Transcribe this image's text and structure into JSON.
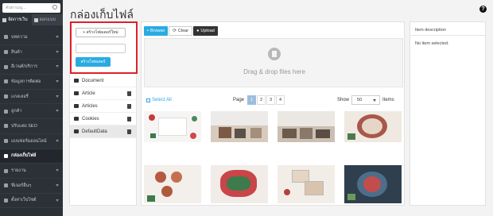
{
  "sidebar": {
    "search_placeholder": "ค้นหาเมนู...",
    "tabs": [
      {
        "label": "จัดการเว็บ",
        "icon": "grid-icon",
        "active": true
      },
      {
        "label": "ออกแบบ",
        "icon": "pen-icon",
        "active": false
      }
    ],
    "items": [
      {
        "label": "บทความ",
        "icon": "article-icon",
        "has_arrow": true
      },
      {
        "label": "สินค้า",
        "icon": "cart-icon",
        "has_arrow": true
      },
      {
        "label": "อีเวนต์/บริการ",
        "icon": "tag-icon",
        "has_arrow": true
      },
      {
        "label": "ข้อมูลการติดต่อ",
        "icon": "contact-icon",
        "has_arrow": true
      },
      {
        "label": "แกลเลอรี่",
        "icon": "gallery-icon",
        "has_arrow": true
      },
      {
        "label": "ลูกค้า",
        "icon": "users-icon",
        "has_arrow": true
      },
      {
        "label": "ปรับแต่ง SEO",
        "icon": "search-icon",
        "has_arrow": false
      },
      {
        "label": "แบบฟอร์มออนไลน์",
        "icon": "form-icon",
        "has_arrow": true
      },
      {
        "label": "กล่องเก็บไฟล์",
        "icon": "folder-icon",
        "has_arrow": false,
        "active": true
      },
      {
        "label": "รายงาน",
        "icon": "report-icon",
        "has_arrow": true
      },
      {
        "label": "ฟีเจอร์อื่นๆ",
        "icon": "puzzle-icon",
        "has_arrow": true
      },
      {
        "label": "ตั้งค่าเว็บไซต์",
        "icon": "gear-icon",
        "has_arrow": true
      }
    ]
  },
  "page": {
    "title": "กล่องเก็บไฟล์"
  },
  "folders": {
    "new_folder_label": "+ สร้างโฟลเดอร์ใหม่",
    "folder_name_value": "",
    "create_label": "สร้างโฟลเดอร์",
    "list": [
      {
        "name": "Document",
        "deletable": false
      },
      {
        "name": "Article",
        "deletable": true
      },
      {
        "name": "Articles",
        "deletable": true
      },
      {
        "name": "Cookies",
        "deletable": true
      },
      {
        "name": "DefaultData",
        "deletable": true,
        "active": true
      }
    ]
  },
  "toolbar": {
    "browse_label": "Browse",
    "clear_label": "Clear",
    "upload_label": "Upload"
  },
  "dropzone": {
    "text": "Drag & drop files here"
  },
  "listing": {
    "select_all_label": "Select All",
    "page_label": "Page",
    "pages": [
      "1",
      "2",
      "3",
      "4"
    ],
    "current_page": "1",
    "show_label": "Show",
    "show_value": "50",
    "items_label": "Items"
  },
  "details": {
    "title": "Item description",
    "empty_text": "No item selected."
  },
  "colors": {
    "accent": "#29abe2",
    "sidebar_bg": "#2c3138",
    "highlight": "#e0202a"
  }
}
